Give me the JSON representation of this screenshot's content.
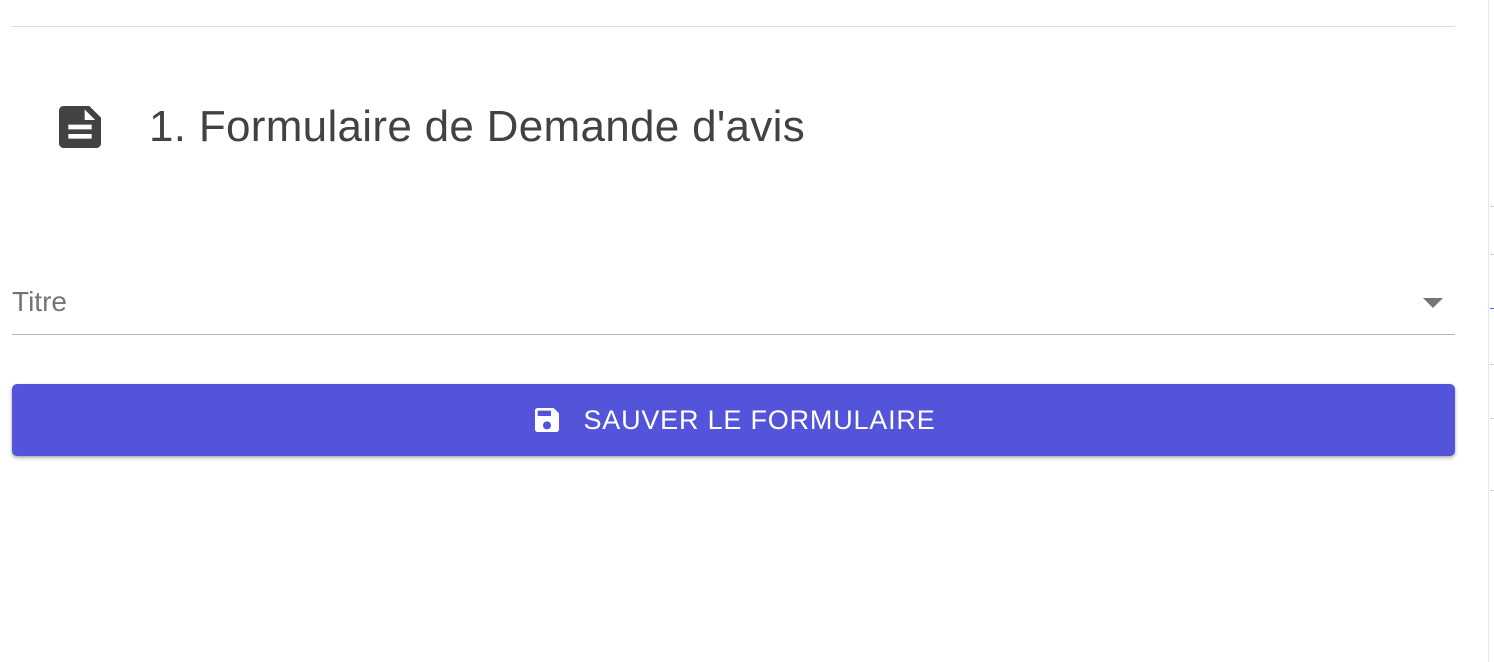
{
  "section": {
    "title": "1. Formulaire de Demande d'avis",
    "icon": "document-icon"
  },
  "form": {
    "title_field": {
      "label": "Titre",
      "value": "",
      "icon": "dropdown-arrow-icon"
    },
    "save_button": {
      "label": "SAUVER LE FORMULAIRE",
      "icon": "save-icon"
    }
  },
  "colors": {
    "primary": "#5454db",
    "title_text": "#424242",
    "label_text": "#757575",
    "divider": "#dcdcdc"
  }
}
